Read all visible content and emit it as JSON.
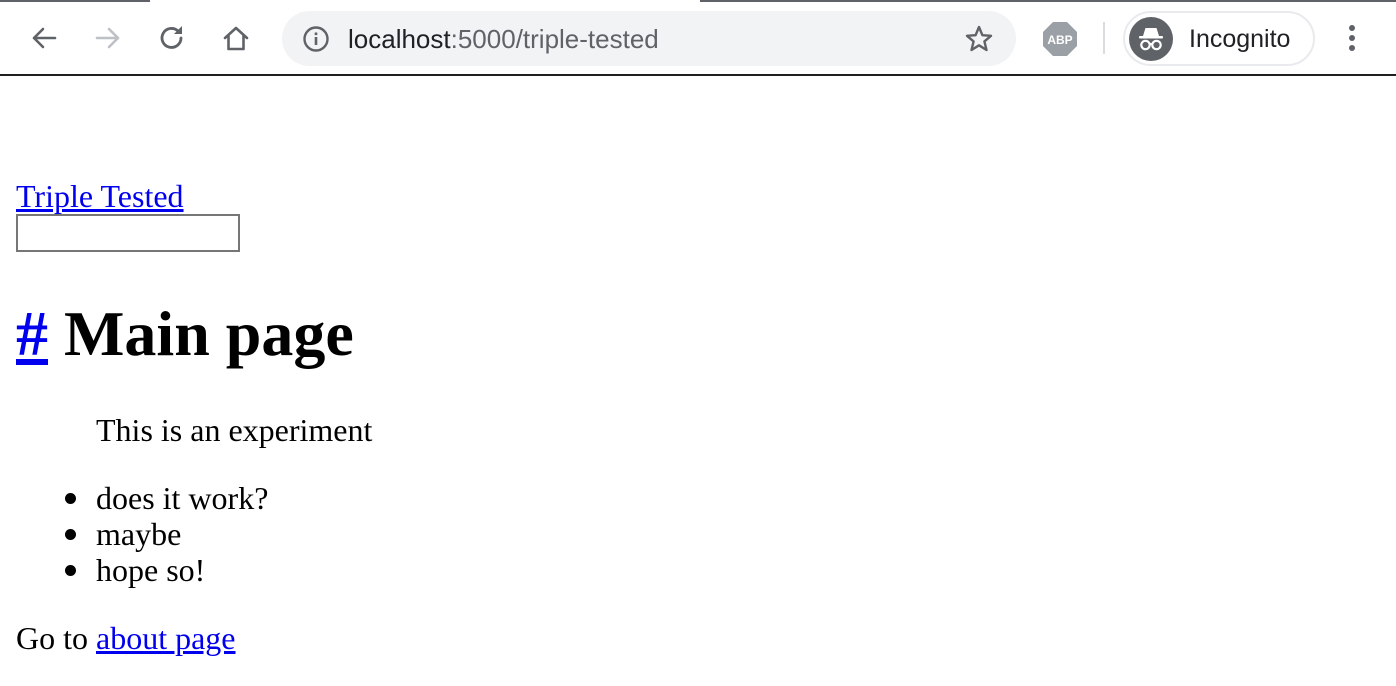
{
  "toolbar": {
    "url_host": "localhost",
    "url_path": ":5000/triple-tested",
    "profile_label": "Incognito",
    "icons": {
      "back": "back-arrow-icon",
      "forward": "forward-arrow-icon",
      "reload": "reload-icon",
      "home": "home-icon",
      "info": "info-icon",
      "bookmark": "star-icon",
      "adblock": "abp-icon",
      "incognito": "incognito-icon",
      "menu": "kebab-menu-icon"
    }
  },
  "page": {
    "site_link": "Triple Tested",
    "search_value": "",
    "heading_anchor": "#",
    "heading_text": " Main page",
    "quote": "This is an experiment",
    "list": [
      "does it work?",
      "maybe",
      "hope so!"
    ],
    "goto_prefix": "Go to ",
    "goto_link": "about page"
  },
  "colors": {
    "link": "#0000ee",
    "omnibox_bg": "#f1f3f4",
    "icon_gray": "#5f6368"
  }
}
